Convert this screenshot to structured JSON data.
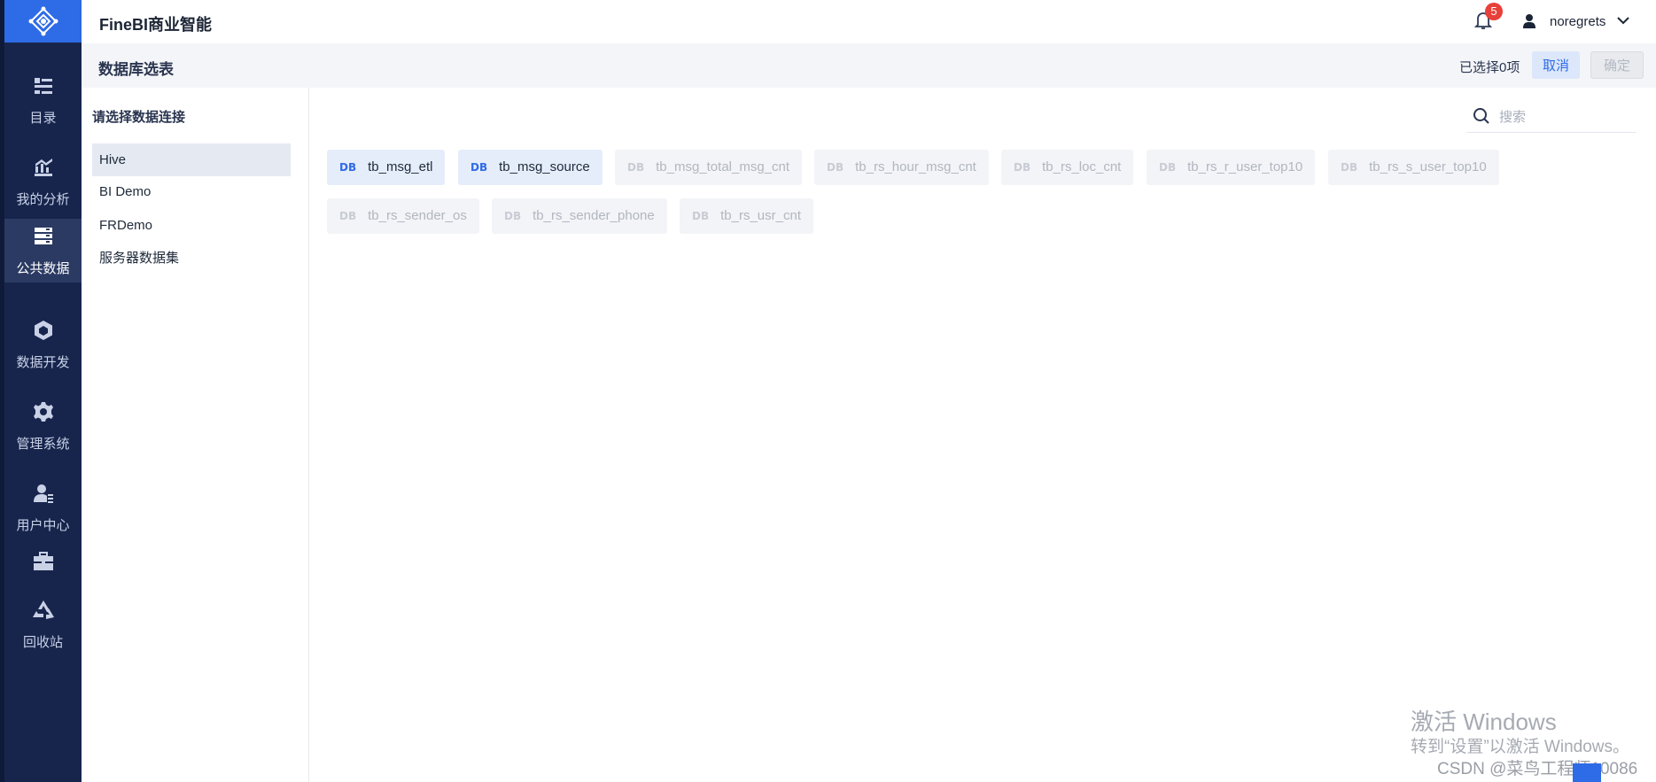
{
  "app": {
    "title": "FineBI商业智能"
  },
  "nav": {
    "items": [
      {
        "label": "目录",
        "icon": "catalog-icon"
      },
      {
        "label": "我的分析",
        "icon": "analysis-icon"
      },
      {
        "label": "公共数据",
        "icon": "public-data-icon",
        "active": true
      },
      {
        "label": "数据开发",
        "icon": "data-dev-icon"
      },
      {
        "label": "管理系统",
        "icon": "gear-icon"
      },
      {
        "label": "用户中心",
        "icon": "user-center-icon"
      },
      {
        "label": "",
        "icon": "toolbox-icon"
      },
      {
        "label": "回收站",
        "icon": "recycle-icon"
      }
    ]
  },
  "header": {
    "notification_count": "5",
    "username": "noregrets"
  },
  "subbar": {
    "title": "数据库选表",
    "selected_text": "已选择0项",
    "cancel_label": "取消",
    "ok_label": "确定"
  },
  "side": {
    "title": "请选择数据连接",
    "connections": [
      "Hive",
      "BI Demo",
      "FRDemo",
      "服务器数据集"
    ],
    "active_index": 0
  },
  "search": {
    "placeholder": "搜索"
  },
  "tables": {
    "badge": "DB",
    "items": [
      {
        "name": "tb_msg_etl",
        "enabled": true
      },
      {
        "name": "tb_msg_source",
        "enabled": true
      },
      {
        "name": "tb_msg_total_msg_cnt",
        "enabled": false
      },
      {
        "name": "tb_rs_hour_msg_cnt",
        "enabled": false
      },
      {
        "name": "tb_rs_loc_cnt",
        "enabled": false
      },
      {
        "name": "tb_rs_r_user_top10",
        "enabled": false
      },
      {
        "name": "tb_rs_s_user_top10",
        "enabled": false
      },
      {
        "name": "tb_rs_sender_os",
        "enabled": false
      },
      {
        "name": "tb_rs_sender_phone",
        "enabled": false
      },
      {
        "name": "tb_rs_usr_cnt",
        "enabled": false
      }
    ]
  },
  "watermark": {
    "line1": "激活 Windows",
    "line2": "转到“设置”以激活 Windows。",
    "line3": "CSDN @菜鸟工程师10086"
  },
  "colors": {
    "nav_bg": "#17254d",
    "accent": "#2e6be6",
    "badge": "#e8403a"
  }
}
